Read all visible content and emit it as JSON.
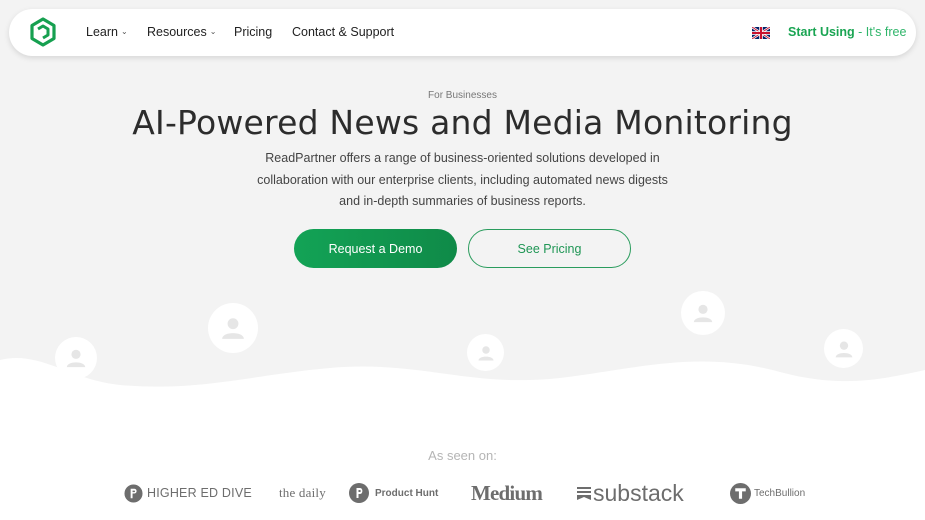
{
  "nav": {
    "items": [
      {
        "label": "Learn",
        "has_dropdown": true
      },
      {
        "label": "Resources",
        "has_dropdown": true
      },
      {
        "label": "Pricing",
        "has_dropdown": false
      },
      {
        "label": "Contact & Support",
        "has_dropdown": false
      }
    ],
    "language_flag": "uk-flag-icon",
    "cta": {
      "label": "Start Using",
      "suffix": "- It's free"
    }
  },
  "hero": {
    "eyebrow": "For Businesses",
    "title": "AI-Powered News and Media Monitoring",
    "description": "ReadPartner offers a range of business-oriented solutions developed in collaboration with our enterprise clients, including automated news digests and in-depth summaries of business reports.",
    "primary_button": "Request a Demo",
    "secondary_button": "See Pricing"
  },
  "seen_on": {
    "label": "As seen on:",
    "logos": [
      "HIGHER ED DIVE",
      "the daily",
      "Product Hunt",
      "Medium",
      "substack",
      "TechBullion"
    ]
  },
  "colors": {
    "accent_green": "#1aa553",
    "background": "#f3f3f3"
  }
}
